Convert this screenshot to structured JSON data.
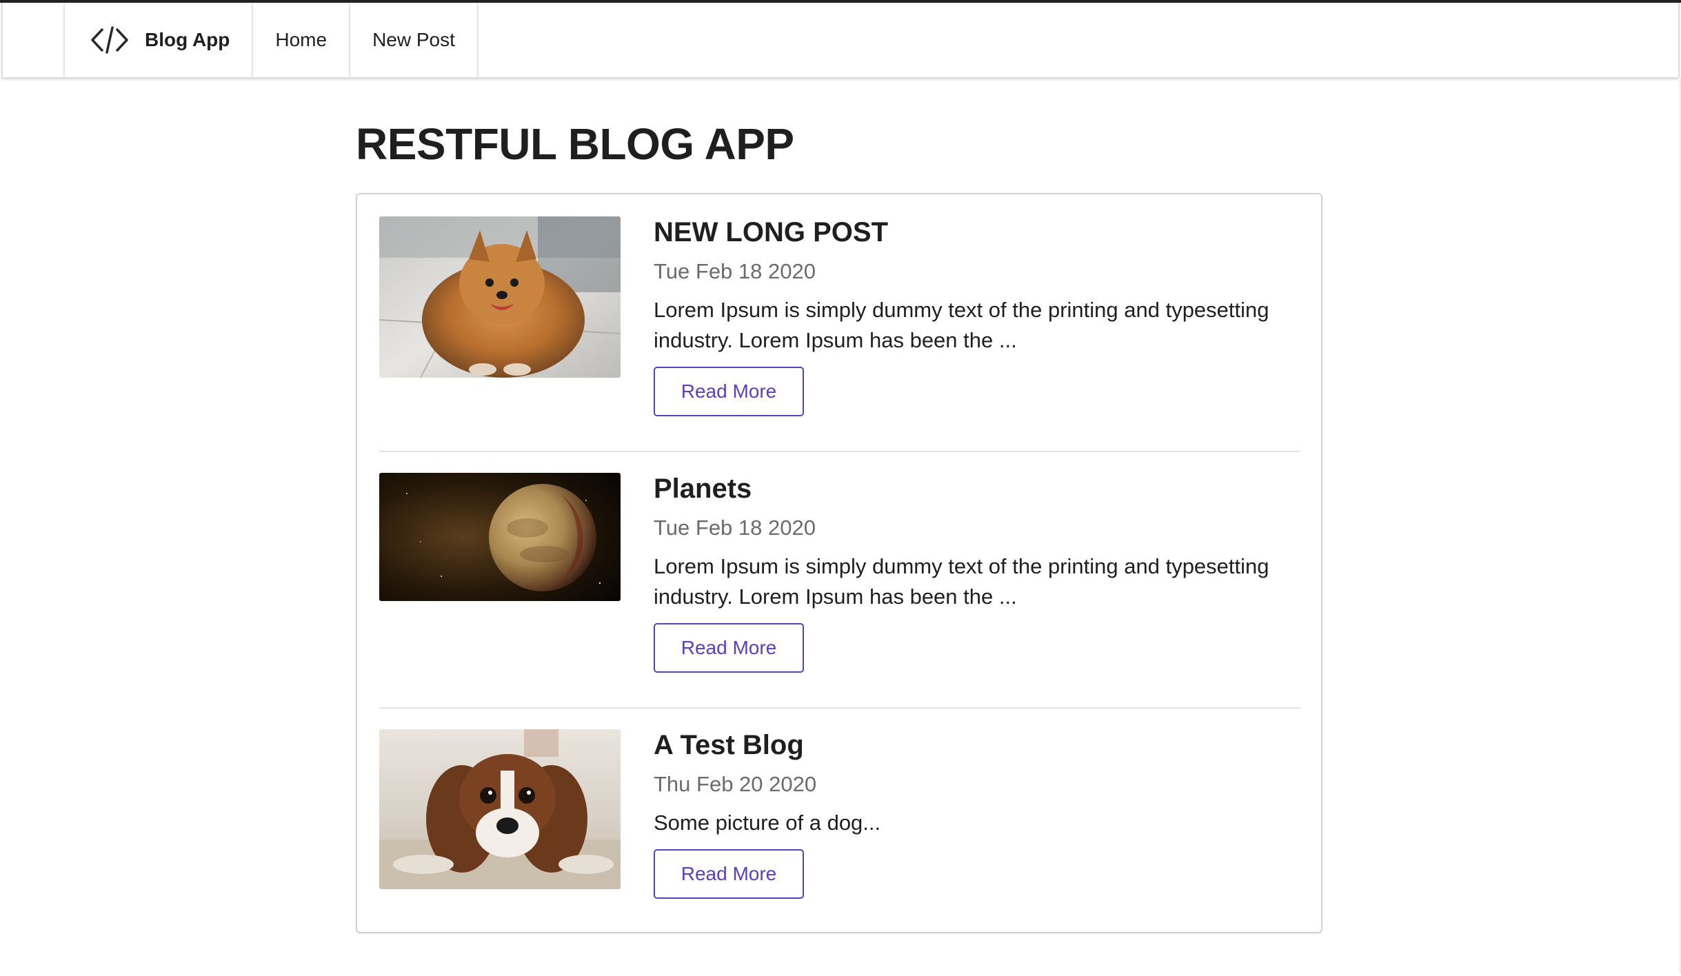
{
  "nav": {
    "brand": "Blog App",
    "home": "Home",
    "new_post": "New Post",
    "brand_icon": "code-icon"
  },
  "page": {
    "title": "RESTFUL BLOG APP"
  },
  "colors": {
    "accent": "#5a3fc0",
    "muted_text": "#6b6b6b"
  },
  "posts": [
    {
      "title": "NEW LONG POST",
      "date": "Tue Feb 18 2020",
      "body": "Lorem Ipsum is simply dummy text of the printing and typesetting industry. Lorem Ipsum has been the ...",
      "button": "Read More",
      "image": "pomeranian-dog-photo"
    },
    {
      "title": "Planets",
      "date": "Tue Feb 18 2020",
      "body": "Lorem Ipsum is simply dummy text of the printing and typesetting industry. Lorem Ipsum has been the ...",
      "button": "Read More",
      "image": "planet-in-space-photo"
    },
    {
      "title": "A Test Blog",
      "date": "Thu Feb 20 2020",
      "body": "Some picture of a dog...",
      "button": "Read More",
      "image": "spaniel-dog-photo"
    }
  ]
}
